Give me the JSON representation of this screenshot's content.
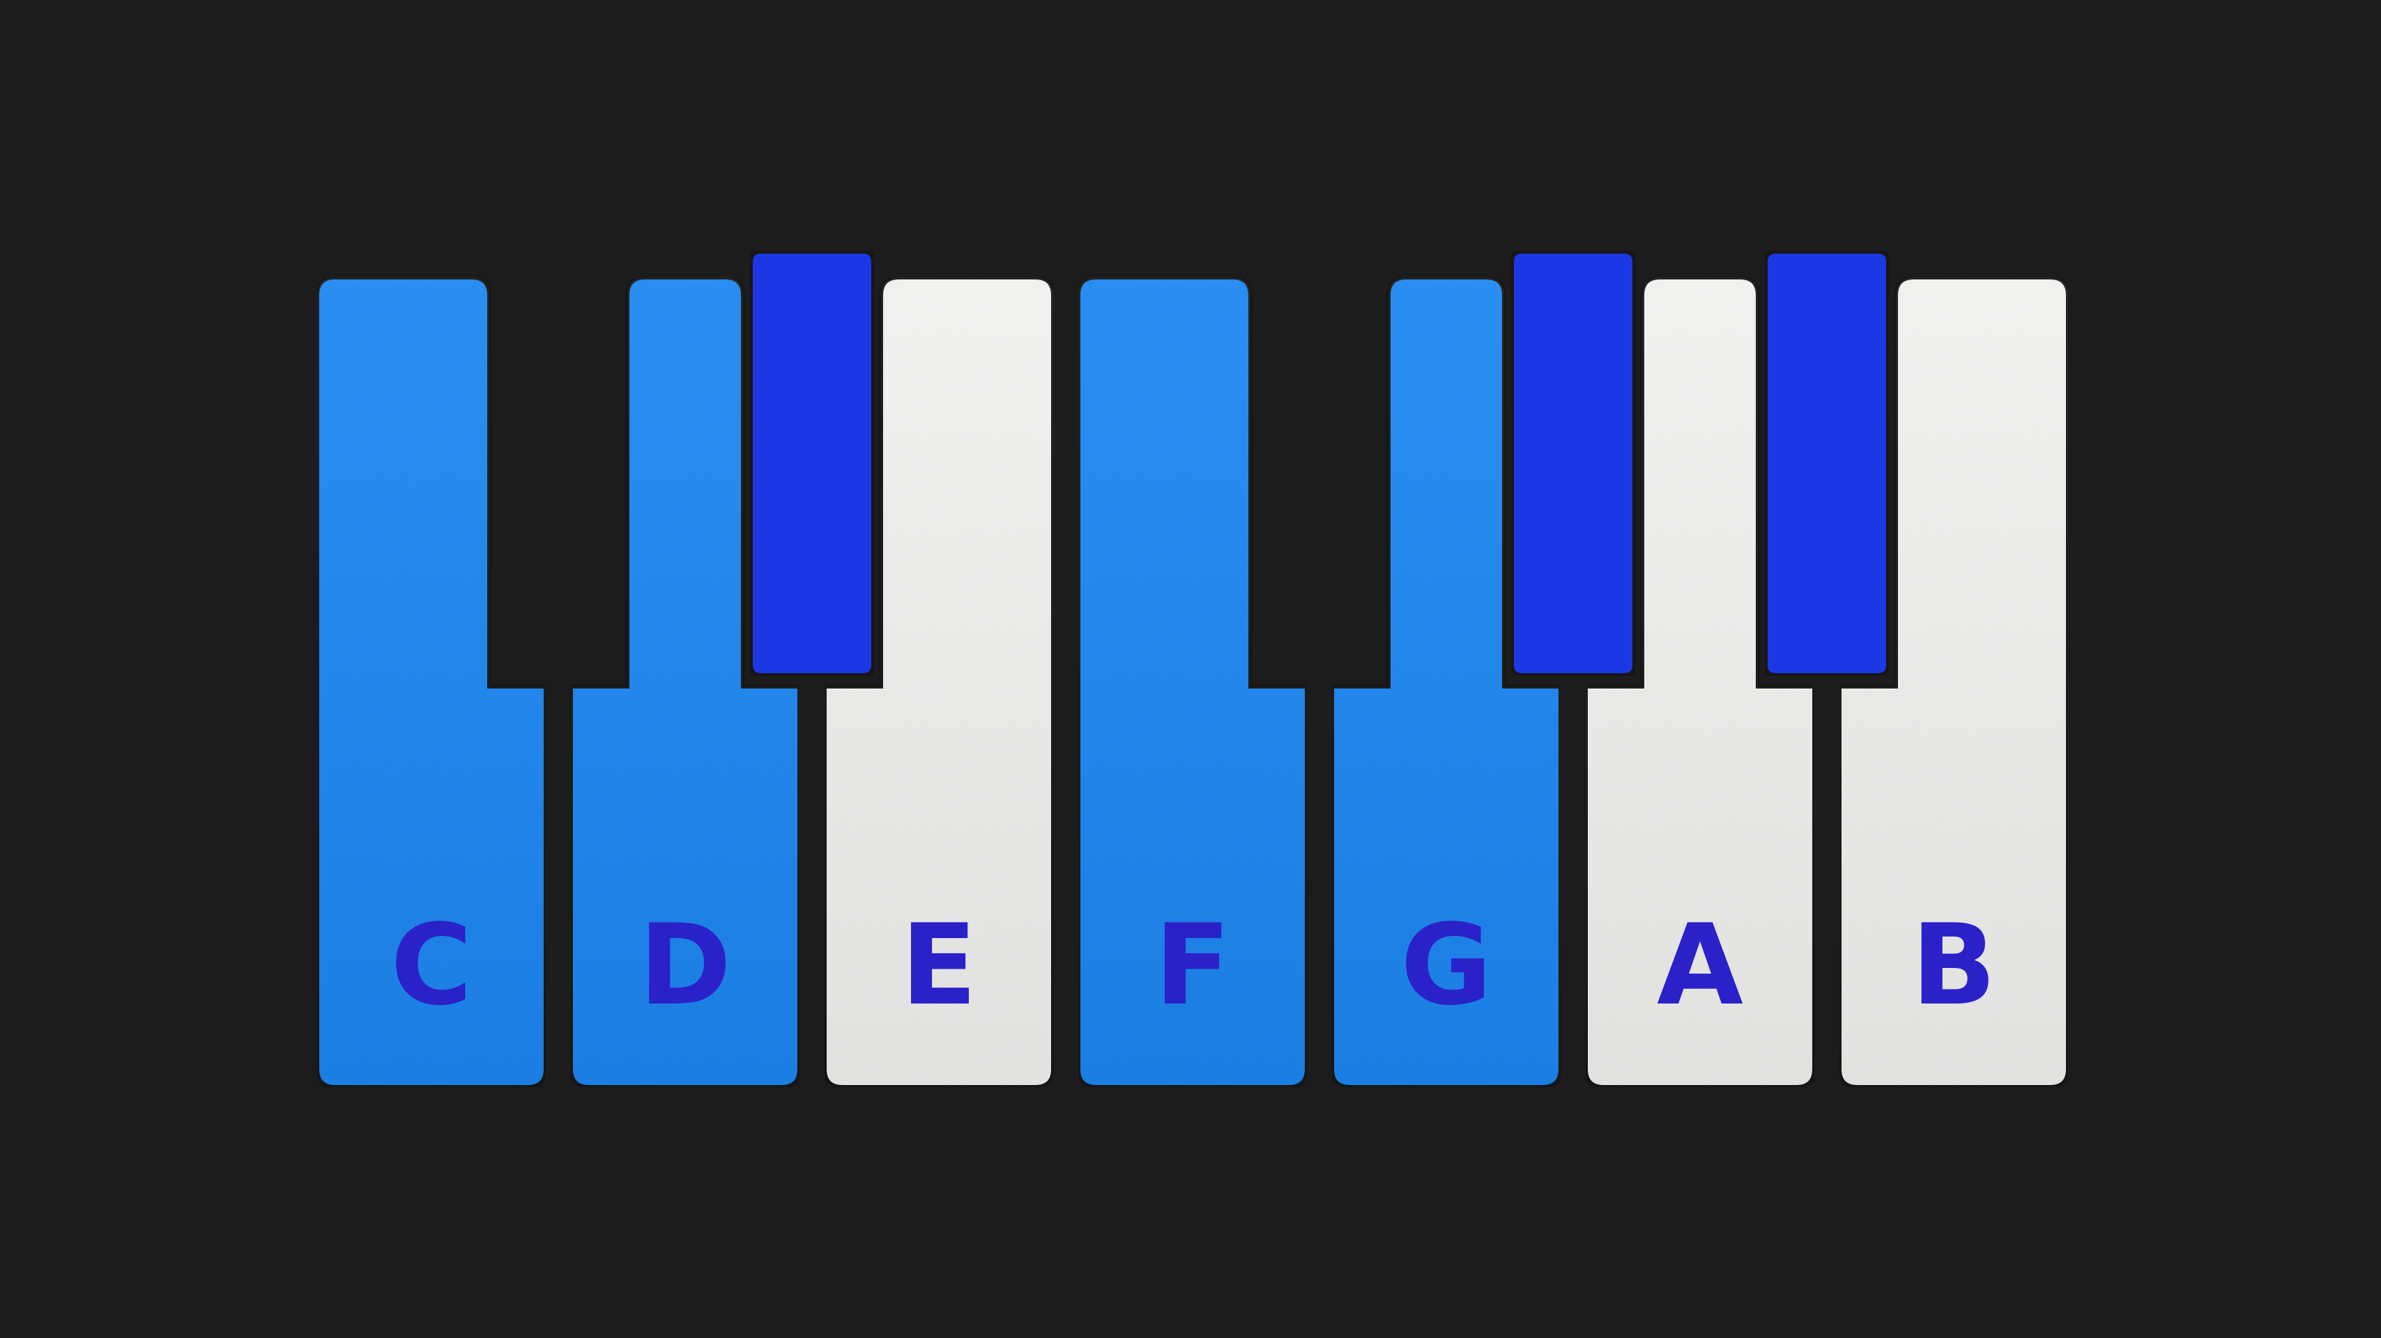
{
  "keyboard": {
    "colors": {
      "background": "#1c1c1c",
      "key_blue": "#1e88f4",
      "key_white": "#f3f3f1",
      "black_key": "#1d38e8",
      "label": "#2a21c9",
      "outline": "#141414"
    },
    "white_keys": [
      {
        "label": "C",
        "highlighted": true
      },
      {
        "label": "D",
        "highlighted": true
      },
      {
        "label": "E",
        "highlighted": false
      },
      {
        "label": "F",
        "highlighted": true
      },
      {
        "label": "G",
        "highlighted": true
      },
      {
        "label": "A",
        "highlighted": false
      },
      {
        "label": "B",
        "highlighted": false
      }
    ],
    "black_keys": [
      {
        "between": "C-D",
        "visible": false
      },
      {
        "between": "D-E",
        "visible": true
      },
      {
        "between": "F-G",
        "visible": false
      },
      {
        "between": "G-A",
        "visible": true
      },
      {
        "between": "A-B",
        "visible": true
      }
    ]
  }
}
